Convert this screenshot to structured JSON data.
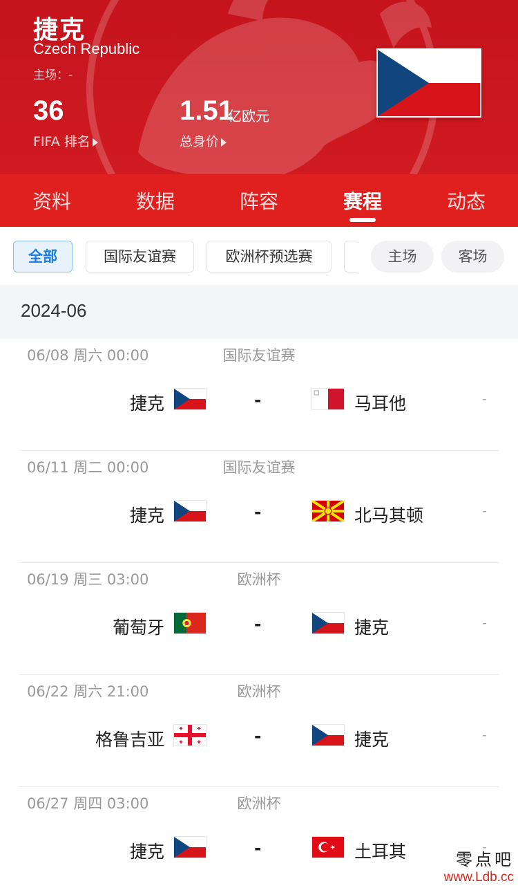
{
  "header": {
    "team_name": "捷克",
    "team_name_en": "Czech Republic",
    "stadium": "主场：-",
    "fifa_rank_value": "36",
    "fifa_rank_label": "FIFA 排名",
    "market_value": "1.51",
    "market_value_unit": "亿欧元",
    "market_value_label": "总身价"
  },
  "tabs": [
    {
      "label": "资料"
    },
    {
      "label": "数据"
    },
    {
      "label": "阵容"
    },
    {
      "label": "赛程",
      "active": true
    },
    {
      "label": "动态"
    }
  ],
  "filters": {
    "chips": [
      {
        "label": "全部",
        "active": true
      },
      {
        "label": "国际友谊赛"
      },
      {
        "label": "欧洲杯预选赛"
      }
    ],
    "venue": [
      {
        "label": "主场"
      },
      {
        "label": "客场"
      }
    ]
  },
  "month": "2024-06",
  "matches": [
    {
      "date": "06/08  周六 00:00",
      "competition": "国际友谊赛",
      "home": "捷克",
      "home_flag": "czech-flag",
      "vs": "-",
      "away": "马耳他",
      "away_flag": "malta-flag",
      "score": "-"
    },
    {
      "date": "06/11  周二 00:00",
      "competition": "国际友谊赛",
      "home": "捷克",
      "home_flag": "czech-flag",
      "vs": "-",
      "away": "北马其顿",
      "away_flag": "north-macedonia-flag",
      "score": "-"
    },
    {
      "date": "06/19  周三 03:00",
      "competition": "欧洲杯",
      "home": "葡萄牙",
      "home_flag": "portugal-flag",
      "vs": "-",
      "away": "捷克",
      "away_flag": "czech-flag",
      "score": "-"
    },
    {
      "date": "06/22  周六 21:00",
      "competition": "欧洲杯",
      "home": "格鲁吉亚",
      "home_flag": "georgia-flag",
      "vs": "-",
      "away": "捷克",
      "away_flag": "czech-flag",
      "score": "-"
    },
    {
      "date": "06/27  周四 03:00",
      "competition": "欧洲杯",
      "home": "捷克",
      "home_flag": "czech-flag",
      "vs": "-",
      "away": "土耳其",
      "away_flag": "turkey-flag",
      "score": "-"
    }
  ],
  "site_logo": {
    "name": "零点吧",
    "url": "www.Ldb.cc"
  },
  "colors": {
    "header_red": "#c6141c",
    "tab_red": "#e0201f",
    "active_chip_blue": "#1b7de0"
  }
}
